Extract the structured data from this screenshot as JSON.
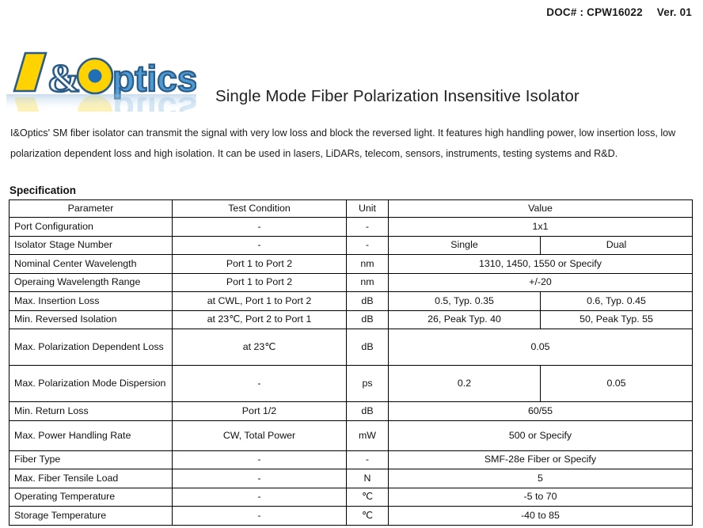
{
  "header": {
    "doc_number_label": "DOC# : CPW16022",
    "version_label": "Ver. 01"
  },
  "logo": {
    "text": "I&Optics",
    "colors": {
      "yellow": "#FFD200",
      "blue": "#1F6FB5",
      "outline": "#2A5C8A"
    }
  },
  "title": "Single Mode Fiber Polarization Insensitive Isolator",
  "description": "I&Optics' SM fiber isolator can transmit the signal with very low loss and block the reversed light. It features high handling power, low insertion loss, low polarization dependent loss and high isolation. It can be used in lasers, LiDARs, telecom, sensors, instruments, testing systems and R&D.",
  "section_label": "Specification",
  "table": {
    "columns": [
      "Parameter",
      "Test Condition",
      "Unit",
      "Value"
    ],
    "rows": [
      {
        "parameter": "Port Configuration",
        "condition": "-",
        "unit": "-",
        "value": "1x1",
        "split": false
      },
      {
        "parameter": "Isolator Stage Number",
        "condition": "-",
        "unit": "-",
        "value_single": "Single",
        "value_dual": "Dual",
        "split": true
      },
      {
        "parameter": "Nominal Center Wavelength",
        "condition": "Port 1 to Port 2",
        "unit": "nm",
        "value": "1310, 1450, 1550 or Specify",
        "split": false
      },
      {
        "parameter": "Operaing Wavelength Range",
        "condition": "Port 1 to Port 2",
        "unit": "nm",
        "value": "+/-20",
        "split": false
      },
      {
        "parameter": "Max. Insertion Loss",
        "condition": "at CWL, Port 1 to Port 2",
        "unit": "dB",
        "value_single": "0.5, Typ. 0.35",
        "value_dual": "0.6, Typ. 0.45",
        "split": true
      },
      {
        "parameter": "Min. Reversed Isolation",
        "condition": "at 23℃, Port 2 to Port 1",
        "unit": "dB",
        "value_single": "26, Peak Typ. 40",
        "value_dual": "50, Peak Typ. 55",
        "split": true
      },
      {
        "parameter": "Max. Polarization Dependent Loss",
        "condition": "at 23℃",
        "unit": "dB",
        "value": "0.05",
        "split": false
      },
      {
        "parameter": "Max. Polarization Mode Dispersion",
        "condition": "-",
        "unit": "ps",
        "value_single": "0.2",
        "value_dual": "0.05",
        "split": true
      },
      {
        "parameter": "Min. Return Loss",
        "condition": "Port 1/2",
        "unit": "dB",
        "value": "60/55",
        "split": false
      },
      {
        "parameter": "Max. Power Handling Rate",
        "condition": "CW, Total Power",
        "unit": "mW",
        "value": "500 or Specify",
        "split": false
      },
      {
        "parameter": "Fiber Type",
        "condition": "-",
        "unit": "-",
        "value": "SMF-28e Fiber or Specify",
        "split": false
      },
      {
        "parameter": "Max. Fiber Tensile Load",
        "condition": "-",
        "unit": "N",
        "value": "5",
        "split": false
      },
      {
        "parameter": "Operating Temperature",
        "condition": "-",
        "unit": "℃",
        "value": "-5 to 70",
        "split": false
      },
      {
        "parameter": "Storage Temperature",
        "condition": "-",
        "unit": "℃",
        "value": "-40 to 85",
        "split": false
      }
    ]
  }
}
